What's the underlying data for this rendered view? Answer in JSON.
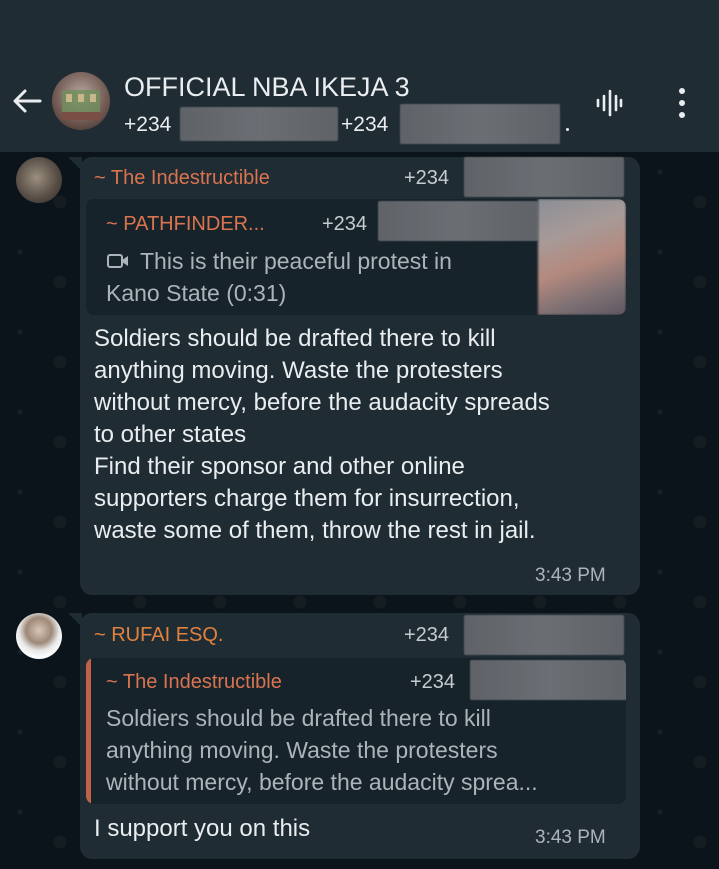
{
  "header": {
    "title": "OFFICIAL NBA IKEJA 3",
    "participants": [
      "+234",
      "+234"
    ],
    "trailing": "."
  },
  "messages": [
    {
      "sender": "~ The Indestructible",
      "sender_color": "#d9744f",
      "phone": "+234",
      "quote": {
        "sender": "~ PATHFINDER...",
        "sender_color": "#d9744f",
        "phone": "+234",
        "lines": [
          "This is their peaceful protest in",
          "Kano State (0:31)"
        ]
      },
      "lines": [
        "Soldiers should be drafted there to kill",
        "anything moving. Waste the protesters",
        "without mercy, before the audacity spreads",
        "to other states",
        "Find their sponsor and other online",
        "supporters charge them for insurrection,",
        "waste some of them, throw the rest in jail."
      ],
      "time": "3:43 PM"
    },
    {
      "sender": "~ RUFAI ESQ.",
      "sender_color": "#e0823f",
      "phone": "+234",
      "quote": {
        "sender": "~ The Indestructible",
        "sender_color": "#d9744f",
        "phone": "+234",
        "lines": [
          "Soldiers should be drafted there to kill",
          "anything moving. Waste the protesters",
          "without mercy, before the audacity sprea..."
        ]
      },
      "lines": [
        "I support you on this"
      ],
      "time": "3:43 PM"
    }
  ]
}
